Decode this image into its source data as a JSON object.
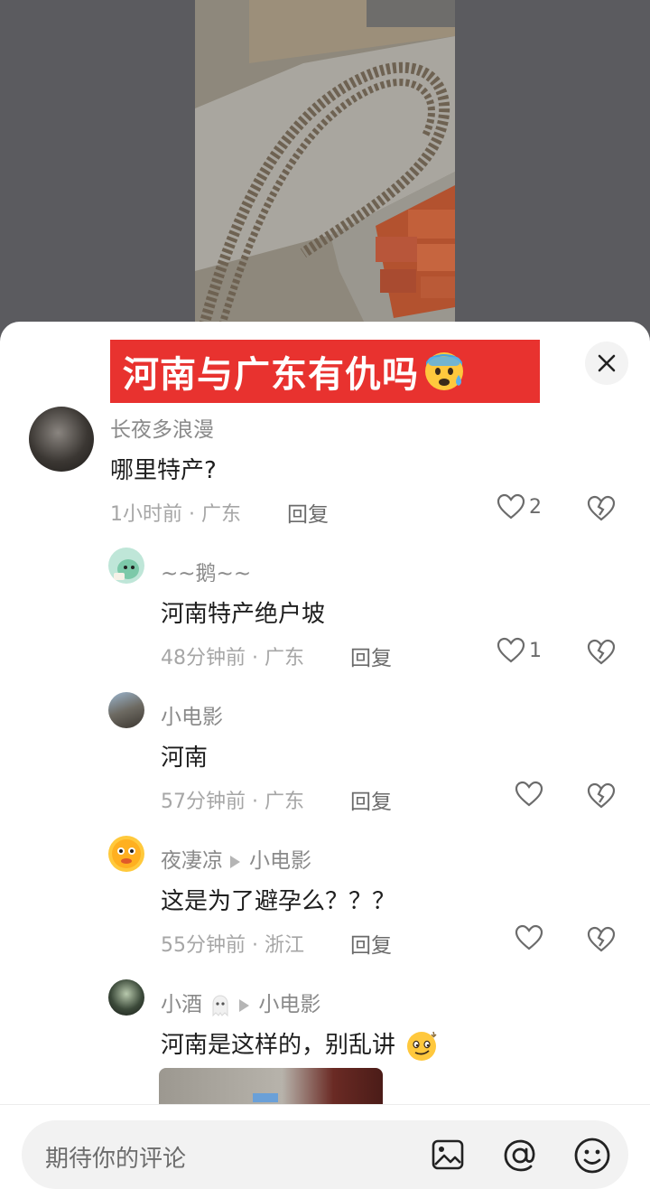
{
  "banner": {
    "text": "河南与广东有仇吗",
    "emoji": "anxious-sweat-face"
  },
  "comments": [
    {
      "user": "长夜多浪漫",
      "text": "哪里特产?",
      "time": "1小时前 · 广东",
      "reply": "回复",
      "likes": "2"
    },
    {
      "user": "~~鹅~~",
      "text": "河南特产绝户坡",
      "time": "48分钟前 · 广东",
      "reply": "回复",
      "likes": "1"
    },
    {
      "user": "小电影",
      "text": "河南",
      "time": "57分钟前 · 广东",
      "reply": "回复",
      "likes": ""
    },
    {
      "user": "夜凄凉",
      "reply_to": "小电影",
      "text": "这是为了避孕么？？？",
      "time": "55分钟前 · 浙江",
      "reply": "回复",
      "likes": ""
    },
    {
      "user": "小酒",
      "reply_to": "小电影",
      "text": "河南是这样的，别乱讲",
      "time": "",
      "reply": "",
      "likes": ""
    }
  ],
  "input": {
    "placeholder": "期待你的评论"
  },
  "icons": [
    "close-icon",
    "heart-icon",
    "broken-heart-icon",
    "image-icon",
    "at-icon",
    "emoji-icon"
  ],
  "colors": {
    "banner": "#e8322f",
    "sheet": "#ffffff",
    "backdrop": "#5d5d61"
  }
}
